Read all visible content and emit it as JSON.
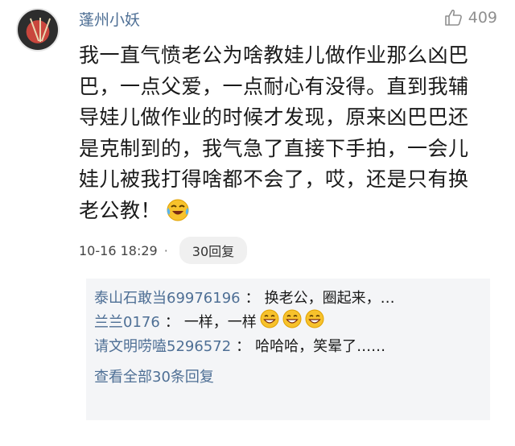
{
  "comment": {
    "username": "蓬州小妖",
    "likes": "409",
    "lines": [
      "我一直气愤老公为啥教娃儿做作业那么凶巴",
      "巴，一点父爱，一点耐心有没得。直到我辅",
      "导娃儿做作业的时候才发现，原来凶巴巴还",
      "是克制到的，我气急了直接下手拍，一会儿",
      "娃儿被我打得啥都不会了，哎，还是只有换",
      "老公教！"
    ],
    "emoji": "laughing-tears-emoji",
    "timestamp": "10-16 18:29",
    "dot": "·",
    "reply_count_label": "30回复"
  },
  "replies": [
    {
      "name": "泰山石敢当69976196",
      "sep": "：",
      "text": "换老公，圈起来，…"
    },
    {
      "name": "兰兰0176",
      "sep": "：",
      "text": "一样，一样",
      "emojis": [
        "grinning-emoji",
        "grinning-emoji",
        "grinning-emoji"
      ]
    },
    {
      "name": "请文明唠嗑5296572",
      "sep": "：",
      "text": "哈哈哈，笑晕了……"
    }
  ],
  "view_all_label": "查看全部30条回复",
  "colors": {
    "name": "#4e6f95",
    "muted": "#8f8f8f",
    "reply_bg": "#f4f5f7"
  }
}
